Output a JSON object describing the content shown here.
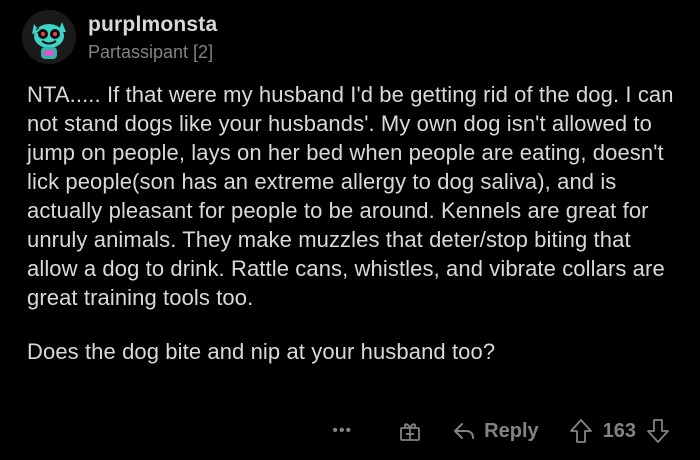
{
  "comment": {
    "author": "purplmonsta",
    "flair": "Partassipant [2]",
    "paragraphs": [
      "NTA..... If that were my husband I'd be getting rid of the dog. I can not stand dogs like your husbands'. My own dog isn't allowed to jump on people, lays on her bed when people are eating, doesn't lick people(son has an extreme allergy to dog saliva), and is actually pleasant for people to be around. Kennels are great for unruly animals. They make muzzles that deter/stop biting that allow a dog to drink. Rattle cans, whistles, and vibrate collars are great training tools too.",
      "Does the dog bite and nip at your husband too?"
    ]
  },
  "actions": {
    "more_label": "•••",
    "reply_label": "Reply",
    "score": "163"
  },
  "icons": {
    "avatar": "monster-avatar",
    "more": "more-options-icon",
    "gift": "award-icon",
    "reply": "reply-arrow-icon",
    "upvote": "upvote-arrow-icon",
    "downvote": "downvote-arrow-icon"
  },
  "colors": {
    "background": "#000000",
    "text": "#d7dadc",
    "muted": "#818384",
    "avatar_accent": "#3fd3c6"
  }
}
